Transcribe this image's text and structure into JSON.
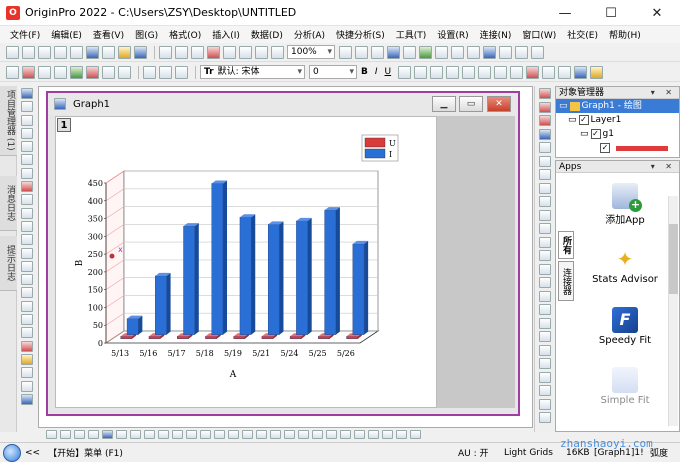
{
  "window": {
    "title": "OriginPro 2022 - C:\\Users\\ZSY\\Desktop\\UNTITLED",
    "icon": "origin-app-icon",
    "minimize": "—",
    "maximize": "☐",
    "close": "✕"
  },
  "menu": [
    "文件(F)",
    "编辑(E)",
    "查看(V)",
    "图(G)",
    "格式(O)",
    "插入(I)",
    "数据(D)",
    "分析(A)",
    "快捷分析(S)",
    "工具(T)",
    "设置(R)",
    "连接(N)",
    "窗口(W)",
    "社交(E)",
    "帮助(H)"
  ],
  "toolbar": {
    "zoom": "100%",
    "font_prefix": "Tr",
    "font_name": "默认: 宋体",
    "font_size": "0",
    "bold": "B",
    "italic": "I",
    "underline": "U"
  },
  "left_dock": {
    "tabs": [
      "项目管理器 (1)",
      "消息日志",
      "提示日志"
    ]
  },
  "graph_window": {
    "title": "Graph1",
    "layer_number": "1",
    "min_btn": "▁",
    "max_btn": "▭",
    "close_btn": "✕"
  },
  "object_manager": {
    "title": "对象管理器",
    "controls": "▾ ✕",
    "items": [
      "Graph1 - 绘图",
      "Layer1",
      "g1"
    ]
  },
  "apps": {
    "title": "Apps",
    "tabs": [
      "所有",
      "连接器"
    ],
    "items": [
      {
        "label": "添加App",
        "icon": "add-app-icon"
      },
      {
        "label": "Stats Advisor",
        "icon": "wand-icon"
      },
      {
        "label": "Speedy Fit",
        "icon": "speedy-fit-icon"
      },
      {
        "label": "Simple Fit",
        "icon": "simple-fit-icon"
      }
    ]
  },
  "status": {
    "zoom_icon": "zoom-icon",
    "arrows": "<<",
    "start": "【开始】菜单 (F1)",
    "au": "AU : 开",
    "grids": "Light Grids",
    "size": "16KB",
    "ref": "[Graph1]1!",
    "unit": "弧度"
  },
  "watermark": "zhanshaoyi.com",
  "chart_data": {
    "type": "bar",
    "categories": [
      "5/13",
      "5/16",
      "5/17",
      "5/18",
      "5/19",
      "5/21",
      "5/24",
      "5/25",
      "5/26"
    ],
    "series": [
      {
        "name": "U",
        "values": [
          0,
          0,
          0,
          0,
          0,
          0,
          0,
          0,
          0
        ],
        "color": "#d93a3a"
      },
      {
        "name": "I",
        "values": [
          45,
          165,
          305,
          425,
          330,
          310,
          320,
          350,
          255
        ],
        "color": "#2a6fd6"
      }
    ],
    "xlabel": "A",
    "ylabel": "B",
    "ylim": [
      0,
      450
    ],
    "yticks": [
      0,
      50,
      100,
      150,
      200,
      250,
      300,
      350,
      400,
      450
    ],
    "axis_marker": "x"
  }
}
